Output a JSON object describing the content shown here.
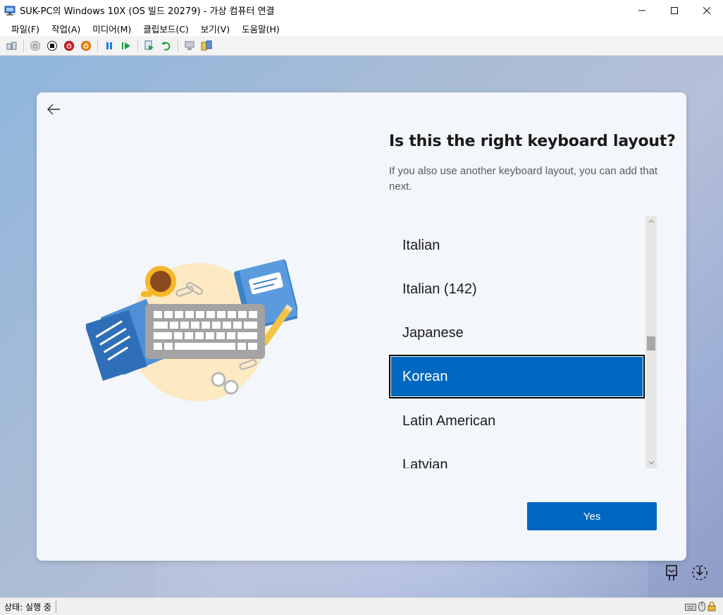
{
  "window": {
    "title": "SUK-PC의 Windows 10X (OS 빌드 20279) - 가상 컴퓨터 연결",
    "minimize": "—",
    "maximize": "☐",
    "close": "✕"
  },
  "menu": {
    "items": [
      "파일(F)",
      "작업(A)",
      "미디어(M)",
      "클립보드(C)",
      "보기(V)",
      "도움말(H)"
    ]
  },
  "toolbar": {
    "icons": [
      "ctrl-alt-del-icon",
      "start-icon",
      "turn-off-icon",
      "shutdown-icon",
      "save-icon",
      "pause-icon",
      "resume-icon",
      "checkpoint-icon",
      "revert-icon",
      "enhanced-session-icon",
      "share-icon"
    ]
  },
  "oobe": {
    "heading": "Is this the right keyboard layout?",
    "subtext": "If you also use another keyboard layout, you can add that next.",
    "layouts": [
      "Italian",
      "Italian (142)",
      "Japanese",
      "Korean",
      "Latin American",
      "Latvian"
    ],
    "selected": "Korean",
    "yes_label": "Yes",
    "scroll_position": 0.48
  },
  "status": {
    "text": "상태: 실행 중"
  },
  "colors": {
    "accent": "#0067c0",
    "card_bg": "#f3f6fa"
  }
}
